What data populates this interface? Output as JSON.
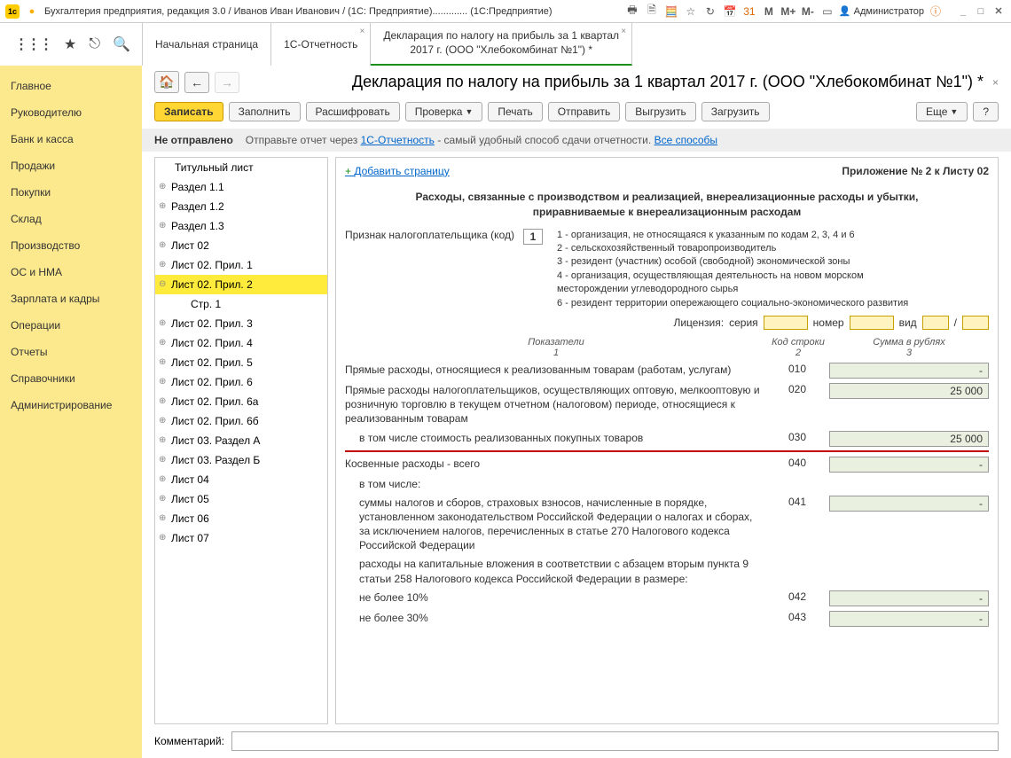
{
  "titlebar": {
    "app_title": "Бухгалтерия предприятия, редакция 3.0 / Иванов Иван Иванович / (1С: Предприятие).............  (1С:Предприятие)",
    "m_labels": [
      "M",
      "M+",
      "M-"
    ],
    "user": "Администратор"
  },
  "toolbar_icons": {
    "apps": "⋮⋮⋮",
    "star": "★",
    "history": "↻",
    "search": "🔍"
  },
  "tabs": {
    "items": [
      {
        "label": "Начальная страница"
      },
      {
        "label": "1С-Отчетность"
      },
      {
        "label_line1": "Декларация по налогу на прибыль за 1 квартал",
        "label_line2": "2017 г. (ООО \"Хлебокомбинат №1\") *"
      }
    ]
  },
  "sidebar": {
    "items": [
      {
        "label": "Главное"
      },
      {
        "label": "Руководителю"
      },
      {
        "label": "Банк и касса"
      },
      {
        "label": "Продажи"
      },
      {
        "label": "Покупки"
      },
      {
        "label": "Склад"
      },
      {
        "label": "Производство"
      },
      {
        "label": "ОС и НМА"
      },
      {
        "label": "Зарплата и кадры"
      },
      {
        "label": "Операции"
      },
      {
        "label": "Отчеты"
      },
      {
        "label": "Справочники"
      },
      {
        "label": "Администрирование"
      }
    ]
  },
  "heading": {
    "title": "Декларация по налогу на прибыль за 1 квартал 2017 г. (ООО \"Хлебокомбинат №1\") *"
  },
  "actions": {
    "write": "Записать",
    "fill": "Заполнить",
    "decode": "Расшифровать",
    "check": "Проверка",
    "print": "Печать",
    "send": "Отправить",
    "upload": "Выгрузить",
    "download": "Загрузить",
    "more": "Еще",
    "help": "?"
  },
  "status": {
    "state": "Не отправлено",
    "prefix": "Отправьте отчет через ",
    "link1": "1С-Отчетность",
    "middle": " - самый удобный способ сдачи отчетности. ",
    "link2": "Все способы"
  },
  "sections": {
    "items": [
      {
        "label": "Титульный лист",
        "selected": false,
        "title": true
      },
      {
        "label": "Раздел 1.1"
      },
      {
        "label": "Раздел 1.2"
      },
      {
        "label": "Раздел 1.3"
      },
      {
        "label": "Лист 02"
      },
      {
        "label": "Лист 02. Прил. 1"
      },
      {
        "label": "Лист 02. Прил. 2",
        "selected": true,
        "expanded": true
      },
      {
        "label": "Стр. 1",
        "sub": true
      },
      {
        "label": "Лист 02. Прил. 3"
      },
      {
        "label": "Лист 02. Прил. 4"
      },
      {
        "label": "Лист 02. Прил. 5"
      },
      {
        "label": "Лист 02. Прил. 6"
      },
      {
        "label": "Лист 02. Прил. 6а"
      },
      {
        "label": "Лист 02. Прил. 6б"
      },
      {
        "label": "Лист 03. Раздел А"
      },
      {
        "label": "Лист 03. Раздел Б"
      },
      {
        "label": "Лист 04"
      },
      {
        "label": "Лист 05"
      },
      {
        "label": "Лист 06"
      },
      {
        "label": "Лист 07"
      }
    ]
  },
  "report": {
    "add_page": "Добавить страницу",
    "attach_label": "Приложение № 2 к Листу 02",
    "form_title": "Расходы, связанные с производством и реализацией, внереализационные расходы и убытки, приравниваемые к внереализационным расходам",
    "taxpayer_label": "Признак налогоплательщика (код)",
    "taxpayer_code": "1",
    "code_hints": [
      "1 - организация, не относящаяся к указанным по кодам 2, 3, 4 и 6",
      "2 - сельскохозяйственный товаропроизводитель",
      "3 - резидент (участник) особой (свободной) экономической зоны",
      "4 - организация, осуществляющая деятельность на новом морском",
      "     месторождении углеводородного сырья",
      "6 - резидент территории опережающего социально-экономического развития"
    ],
    "licence": {
      "label": "Лицензия:",
      "series": "серия",
      "number": "номер",
      "kind": "вид",
      "slash": "/"
    },
    "cols": {
      "c1": "Показатели\n1",
      "c2": "Код строки\n2",
      "c3": "Сумма в рублях\n3"
    },
    "rows": [
      {
        "desc": "Прямые расходы, относящиеся к реализованным товарам (работам, услугам)",
        "code": "010",
        "value": "-"
      },
      {
        "desc": "Прямые расходы налогоплательщиков, осуществляющих оптовую, мелкооптовую и розничную торговлю в текущем отчетном (налоговом) периоде, относящиеся к реализованным товарам",
        "code": "020",
        "value": "25 000"
      },
      {
        "desc": "в том числе стоимость реализованных покупных товаров",
        "code": "030",
        "value": "25 000",
        "indent": true,
        "redline": true
      },
      {
        "desc": "Косвенные расходы - всего",
        "code": "040",
        "value": "-"
      },
      {
        "desc": "в том числе:",
        "code": "",
        "value": "",
        "indent": true
      },
      {
        "desc": "суммы налогов и сборов, страховых взносов, начисленные в порядке, установленном законодательством Российской Федерации о налогах и сборах, за исключением налогов, перечисленных в статье 270 Налогового кодекса Российской Федерации",
        "code": "041",
        "value": "-",
        "indent": true
      },
      {
        "desc": "расходы на капитальные вложения в соответствии с абзацем вторым пункта 9 статьи 258 Налогового кодекса Российской Федерации в размере:",
        "code": "",
        "value": "",
        "indent": true
      },
      {
        "desc": "не более 10%",
        "code": "042",
        "value": "-",
        "indent": true
      },
      {
        "desc": "не более 30%",
        "code": "043",
        "value": "-",
        "indent": true
      }
    ]
  },
  "footer": {
    "comment_label": "Комментарий:",
    "comment_value": ""
  }
}
